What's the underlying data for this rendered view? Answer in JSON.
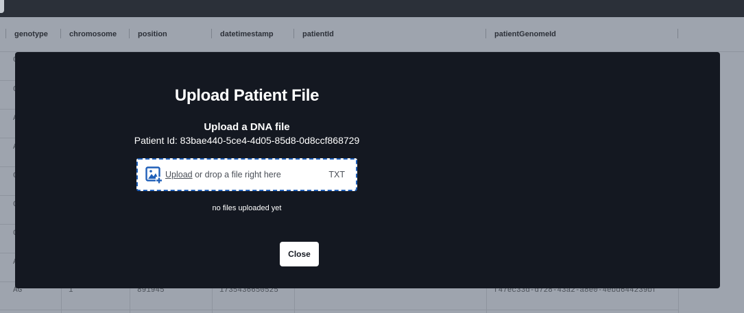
{
  "grid": {
    "columns": [
      "genotype",
      "chromosome",
      "position",
      "datetimestamp",
      "patientId",
      "patientGenomeId"
    ],
    "row_stubs": [
      "G",
      "G",
      "A",
      "A",
      "G",
      "G",
      "G",
      "A"
    ],
    "last_row": {
      "genotype": "AG",
      "chromosome": "1",
      "position": "891945",
      "datetimestamp": "1735436650525",
      "patientGenomeId": "f47ec33d-d728-43a2-a8e0-4ebd644239bf"
    }
  },
  "modal": {
    "title": "Upload Patient File",
    "subtitle": "Upload a DNA file",
    "patient_id_text": "Patient Id: 83bae440-5ce4-4d05-85d8-0d8ccf868729",
    "dropzone": {
      "upload_link": "Upload",
      "hint": " or drop a file right here",
      "accepted_types": "TXT",
      "icon": "image-upload-icon"
    },
    "status": "no files uploaded yet",
    "close_label": "Close"
  },
  "colors": {
    "modal_bg": "#141821",
    "dropzone_border": "#1f5fb8",
    "overlay_bg": "#9ea4ae"
  }
}
